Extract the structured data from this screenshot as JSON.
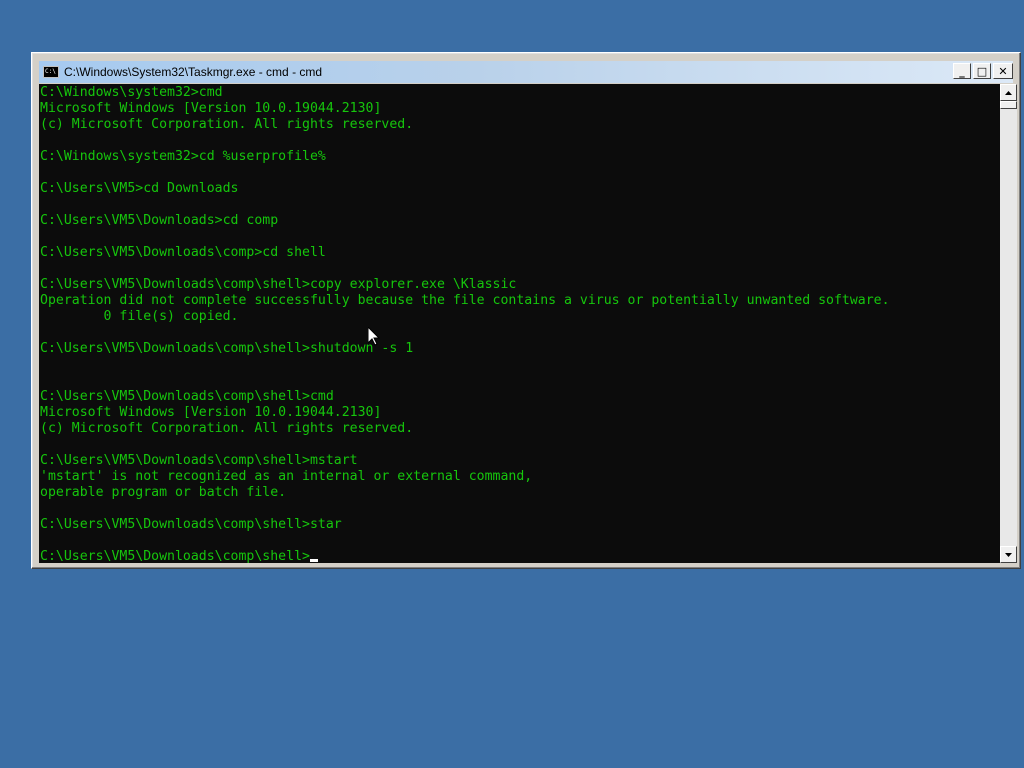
{
  "window": {
    "title": "C:\\Windows\\System32\\Taskmgr.exe - cmd - cmd",
    "icon_label": "C:\\",
    "minimize_glyph": "_",
    "maximize_glyph": "□",
    "close_glyph": "✕"
  },
  "console": {
    "lines": [
      "C:\\Windows\\system32>cmd",
      "Microsoft Windows [Version 10.0.19044.2130]",
      "(c) Microsoft Corporation. All rights reserved.",
      "",
      "C:\\Windows\\system32>cd %userprofile%",
      "",
      "C:\\Users\\VM5>cd Downloads",
      "",
      "C:\\Users\\VM5\\Downloads>cd comp",
      "",
      "C:\\Users\\VM5\\Downloads\\comp>cd shell",
      "",
      "C:\\Users\\VM5\\Downloads\\comp\\shell>copy explorer.exe \\Klassic",
      "Operation did not complete successfully because the file contains a virus or potentially unwanted software.",
      "        0 file(s) copied.",
      "",
      "C:\\Users\\VM5\\Downloads\\comp\\shell>shutdown -s 1",
      "",
      "",
      "C:\\Users\\VM5\\Downloads\\comp\\shell>cmd",
      "Microsoft Windows [Version 10.0.19044.2130]",
      "(c) Microsoft Corporation. All rights reserved.",
      "",
      "C:\\Users\\VM5\\Downloads\\comp\\shell>mstart",
      "'mstart' is not recognized as an internal or external command,",
      "operable program or batch file.",
      "",
      "C:\\Users\\VM5\\Downloads\\comp\\shell>star",
      ""
    ],
    "prompt": "C:\\Users\\VM5\\Downloads\\comp\\shell>",
    "text_color": "#16c60c",
    "background": "#0c0c0c"
  },
  "scrollbar": {
    "up_icon": "scroll-up-arrow",
    "down_icon": "scroll-down-arrow"
  },
  "desktop": {
    "background": "#3b6ea5"
  }
}
